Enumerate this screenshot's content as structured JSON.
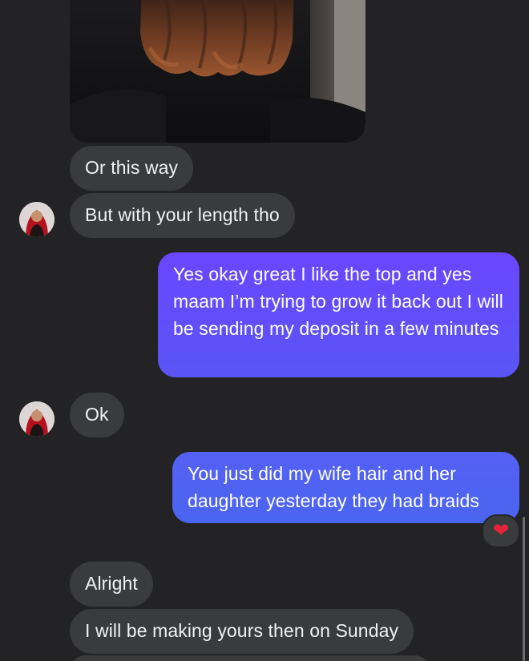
{
  "conversation": {
    "image_message": {
      "description_icon": "hair-photo"
    },
    "messages": [
      {
        "sender": "them",
        "text": "Or this way"
      },
      {
        "sender": "them",
        "text": "But with your length tho"
      },
      {
        "sender": "me",
        "text": "Yes okay great I like the top and yes maam I’m trying to grow it back out I will be sending my deposit in a few minutes"
      },
      {
        "sender": "them",
        "text": "Ok"
      },
      {
        "sender": "me",
        "text": "You just did my wife hair and her daughter yesterday they had braids"
      },
      {
        "sender": "them",
        "text": "Alright"
      },
      {
        "sender": "them",
        "text": "I will be making yours then on Sunday"
      }
    ],
    "reaction": {
      "emoji": "❤",
      "icon": "heart-reaction-icon",
      "color": "#e8243a"
    }
  },
  "colors": {
    "background": "#232325",
    "incoming_bubble": "#3a3b3d",
    "outgoing_gradient_top": "#6a46ff",
    "outgoing_gradient_bottom": "#4b63f0"
  }
}
